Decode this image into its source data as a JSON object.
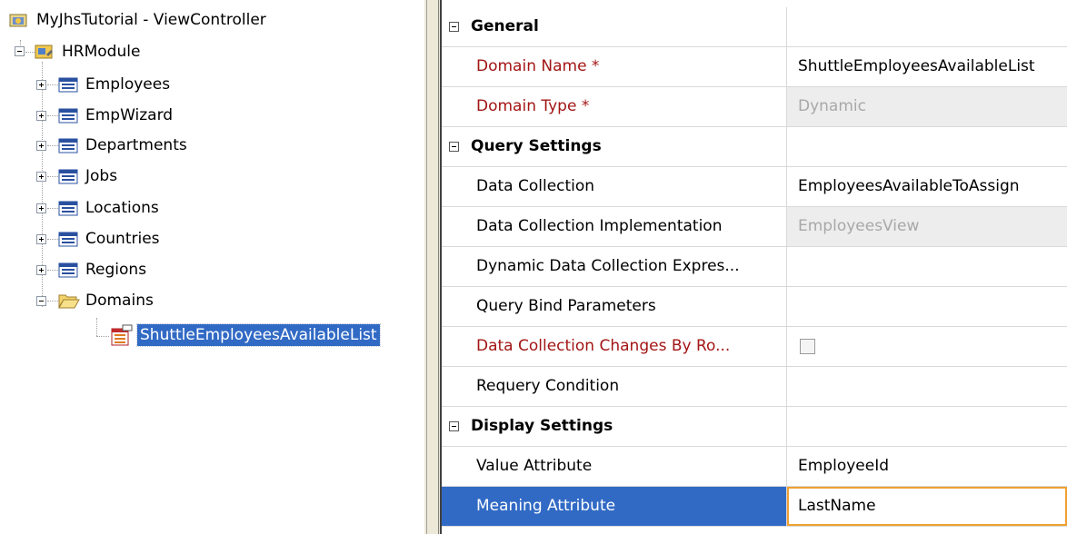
{
  "tree": {
    "root": {
      "label": "MyJhsTutorial - ViewController",
      "icon": "project-icon"
    },
    "module": {
      "label": "HRModule",
      "icon": "module-icon"
    },
    "items": [
      {
        "label": "Employees",
        "icon": "table-icon"
      },
      {
        "label": "EmpWizard",
        "icon": "table-icon"
      },
      {
        "label": "Departments",
        "icon": "table-icon"
      },
      {
        "label": "Jobs",
        "icon": "table-icon"
      },
      {
        "label": "Locations",
        "icon": "table-icon"
      },
      {
        "label": "Countries",
        "icon": "table-icon"
      },
      {
        "label": "Regions",
        "icon": "table-icon"
      },
      {
        "label": "Domains",
        "icon": "folder-open-icon"
      }
    ],
    "domain_child": {
      "label": "ShuttleEmployeesAvailableList",
      "icon": "domain-icon"
    }
  },
  "properties": {
    "general": {
      "title": "General",
      "rows": [
        {
          "name": "Domain Name *",
          "value": "ShuttleEmployeesAvailableList"
        },
        {
          "name": "Domain Type *",
          "value": "Dynamic"
        }
      ]
    },
    "query": {
      "title": "Query Settings",
      "rows": [
        {
          "name": "Data Collection",
          "value": "EmployeesAvailableToAssign"
        },
        {
          "name": "Data Collection Implementation",
          "value": "EmployeesView"
        },
        {
          "name": "Dynamic Data Collection Expres...",
          "value": ""
        },
        {
          "name": "Query Bind Parameters",
          "value": ""
        },
        {
          "name": "Data Collection Changes By Ro...",
          "value": ""
        },
        {
          "name": "Requery Condition",
          "value": ""
        }
      ]
    },
    "display": {
      "title": "Display Settings",
      "rows": [
        {
          "name": "Value Attribute",
          "value": "EmployeeId"
        },
        {
          "name": "Meaning Attribute",
          "value": "LastName"
        }
      ]
    }
  },
  "colors": {
    "selection": "#316ac5",
    "required_text": "#a31515",
    "readonly_bg": "#ededed",
    "focus_border": "#f0a030"
  }
}
